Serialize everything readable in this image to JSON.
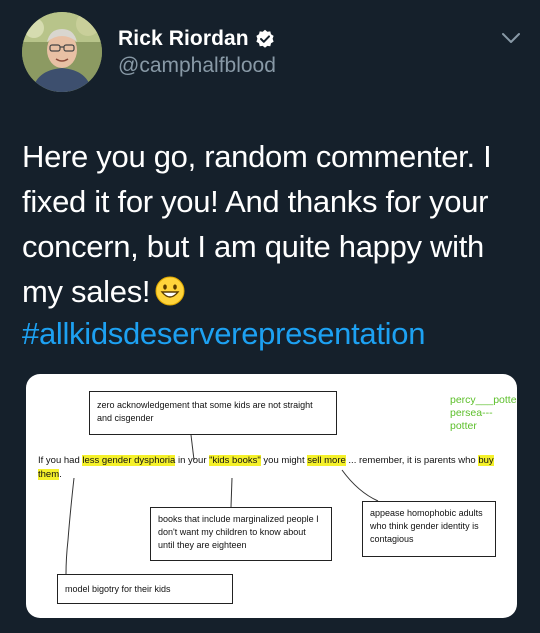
{
  "author": {
    "display_name": "Rick Riordan",
    "handle": "@camphalfblood",
    "verified": true,
    "avatar_icon": "avatar-photo"
  },
  "tweet": {
    "text": "Here you go, random commenter. I fixed it for you! And thanks for your concern, but I am quite happy with my sales!",
    "emoji": "grinning-face",
    "hashtag": "#allkidsdeserverepresentation"
  },
  "media": {
    "boxes": {
      "top": "zero acknowledgement that some kids are not straight and cisgender",
      "middle": "books that include marginalized people I don't want my children to know about until they are eighteen",
      "right": "appease homophobic adults who think gender identity is contagious",
      "bottom": "model bigotry for their kids"
    },
    "sentence": {
      "p1": "If you had ",
      "hl1": "less gender dysphoria",
      "p2": " in your ",
      "hl2": "\"kids books\"",
      "p3": " you might ",
      "hl3": "sell more",
      "p4": " ... remember, it is parents who ",
      "hl4": "buy them",
      "p5": "."
    },
    "annotations": {
      "line1": "percy___potter",
      "line2": "persea---potter"
    }
  },
  "colors": {
    "background": "#15202b",
    "text": "#ffffff",
    "secondary": "#8899a6",
    "link": "#1da1f2",
    "highlight": "#f5f12a",
    "annotation": "#5cbf2a"
  }
}
